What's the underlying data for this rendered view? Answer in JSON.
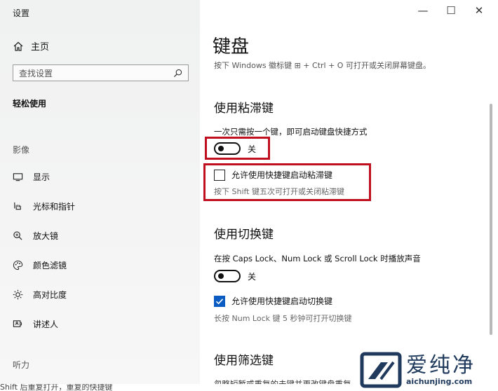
{
  "window": {
    "title": "设置",
    "minimize_glyph": "—",
    "maximize_glyph": "☐",
    "close_glyph": "✕"
  },
  "sidebar": {
    "home": {
      "label": "主页",
      "icon": "home-icon"
    },
    "search": {
      "placeholder": "查找设置",
      "icon": "search-icon"
    },
    "category": "轻松使用",
    "group_vision": "影像",
    "items": [
      {
        "label": "显示",
        "icon": "monitor-icon"
      },
      {
        "label": "光标和指针",
        "icon": "pointer-icon"
      },
      {
        "label": "放大镜",
        "icon": "magnifier-icon"
      },
      {
        "label": "颜色滤镜",
        "icon": "palette-icon"
      },
      {
        "label": "高对比度",
        "icon": "contrast-icon"
      },
      {
        "label": "讲述人",
        "icon": "narrator-icon"
      }
    ],
    "group_hearing": "听力"
  },
  "main": {
    "title": "键盘",
    "subtitle": "按下 Windows 徽标键 ⊞ + Ctrl + O 可打开或关闭屏幕键盘。",
    "sticky": {
      "heading": "使用粘滞键",
      "description": "一次只需按一个键，即可启动键盘快捷方式",
      "toggle_state": "关",
      "toggle_on": false,
      "checkbox_label": "允许使用快捷键启动粘滞键",
      "checkbox_checked": false,
      "hint": "按下 Shift 键五次可打开或关闭粘滞键"
    },
    "toggle_keys": {
      "heading": "使用切换键",
      "description": "在按 Caps Lock、Num Lock 或 Scroll Lock 时播放声音",
      "toggle_state": "关",
      "toggle_on": false,
      "checkbox_label": "允许使用快捷键启动切换键",
      "checkbox_checked": true,
      "hint": "长按 Num Lock 键 5 秒钟可打开切换键"
    },
    "filter_keys": {
      "heading": "使用筛选键",
      "description": "忽略短暂或重复的击键并更改键盘重复"
    }
  },
  "bottom_text": "Shift 后重复打开，重复的快捷键",
  "watermark": {
    "text": "爱纯净",
    "url": "aichunjing.com"
  },
  "colors": {
    "accent": "#0a5cc2",
    "highlight_box": "#c00f1e",
    "sidebar_bg": "#f2f2f2",
    "watermark": "#1f3a5c"
  }
}
